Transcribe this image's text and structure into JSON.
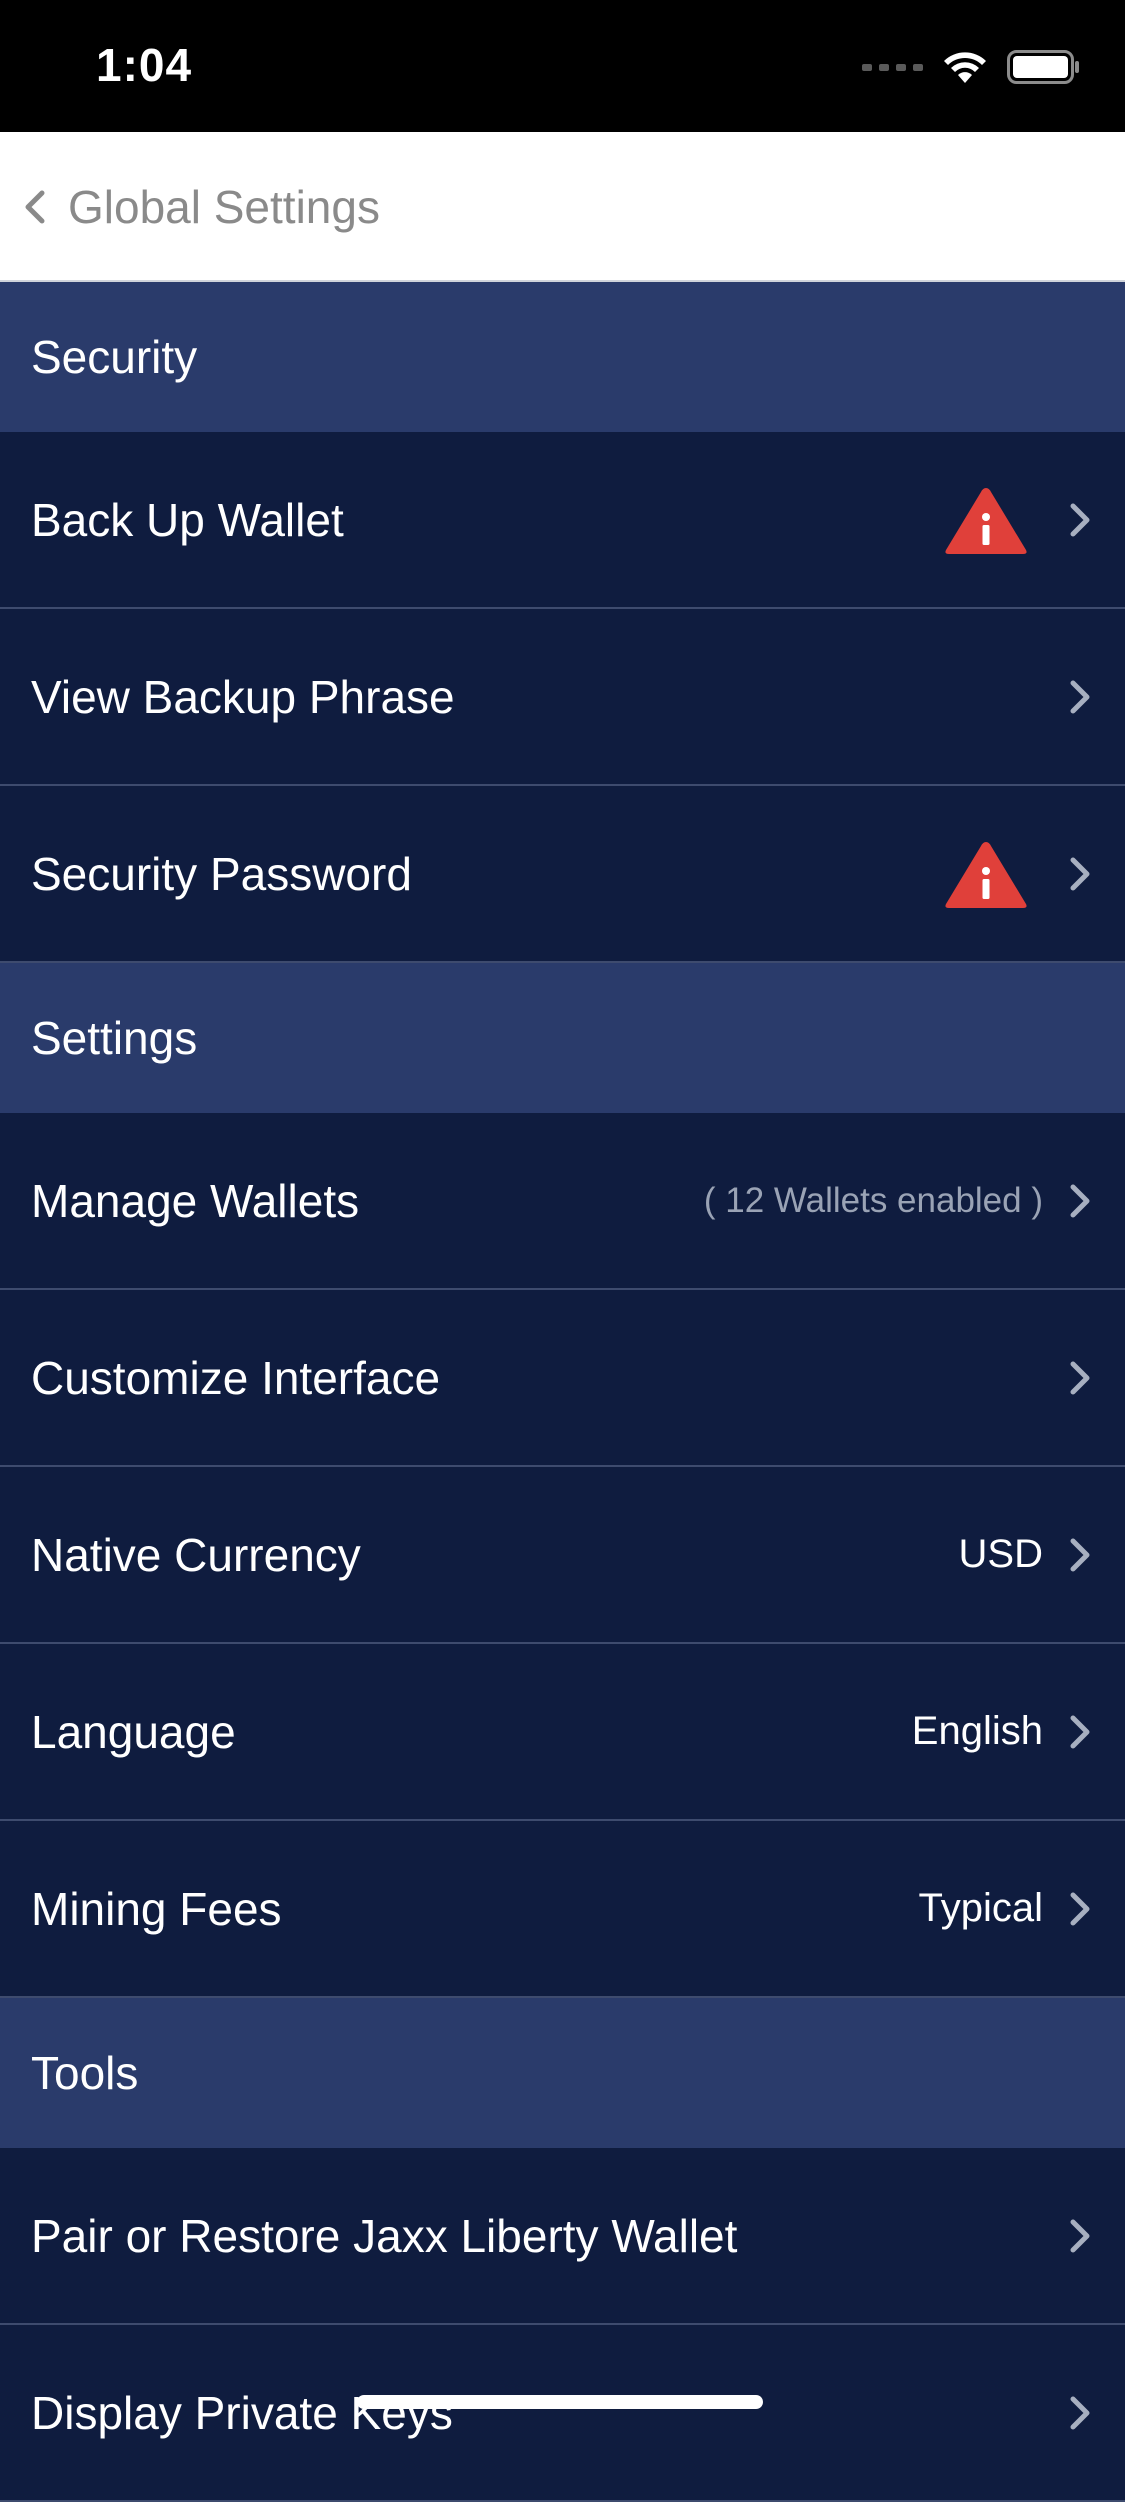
{
  "status_bar": {
    "time": "1:04"
  },
  "nav": {
    "title": "Global Settings"
  },
  "sections": {
    "security": {
      "header": "Security",
      "back_up_wallet": "Back Up Wallet",
      "view_backup_phrase": "View Backup Phrase",
      "security_password": "Security Password"
    },
    "settings": {
      "header": "Settings",
      "manage_wallets": "Manage Wallets",
      "manage_wallets_value": "( 12 Wallets enabled )",
      "customize_interface": "Customize Interface",
      "native_currency": "Native Currency",
      "native_currency_value": "USD",
      "language": "Language",
      "language_value": "English",
      "mining_fees": "Mining Fees",
      "mining_fees_value": "Typical"
    },
    "tools": {
      "header": "Tools",
      "pair_restore": "Pair or Restore Jaxx Liberty Wallet",
      "display_private_keys": "Display Private Keys"
    }
  },
  "colors": {
    "section_header_bg": "#2a3b6b",
    "row_bg": "#0f1c3f",
    "warning": "#e0403a"
  }
}
